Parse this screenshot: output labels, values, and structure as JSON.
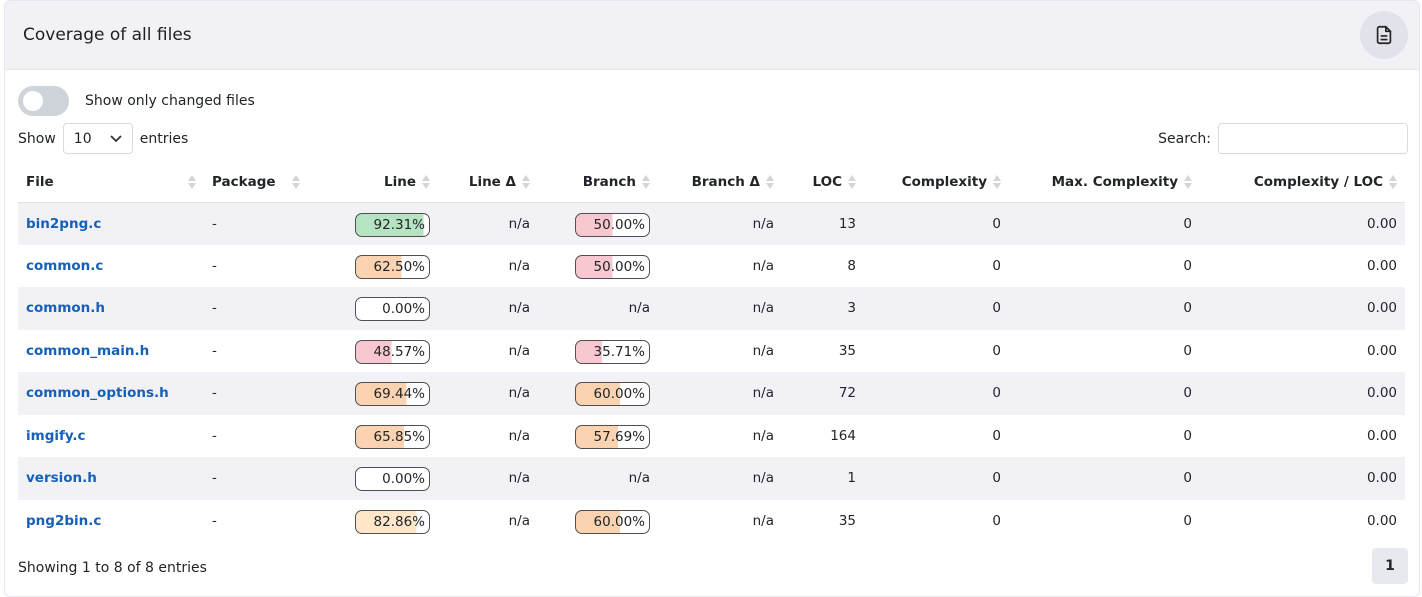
{
  "card": {
    "title": "Coverage of all files",
    "icon": "document-icon"
  },
  "toggle": {
    "label": "Show only changed files"
  },
  "length": {
    "prefix": "Show",
    "value": "10",
    "suffix": "entries"
  },
  "search": {
    "label": "Search:"
  },
  "columns": [
    "File",
    "Package",
    "Line",
    "Line Δ",
    "Branch",
    "Branch Δ",
    "LOC",
    "Complexity",
    "Max. Complexity",
    "Complexity / LOC"
  ],
  "colors": {
    "good": "#b6e3c2",
    "medium": "#fde7c8",
    "warn": "#fbd3b0",
    "bad": "#f9c7d0"
  },
  "rows": [
    {
      "file": "bin2png.c",
      "package": "-",
      "line": "92.31%",
      "line_pct": 92.31,
      "line_color": "good",
      "line_delta": "n/a",
      "branch": "50.00%",
      "branch_pct": 50.0,
      "branch_color": "bad",
      "branch_delta": "n/a",
      "loc": "13",
      "complexity": "0",
      "max_complexity": "0",
      "complexity_loc": "0.00"
    },
    {
      "file": "common.c",
      "package": "-",
      "line": "62.50%",
      "line_pct": 62.5,
      "line_color": "warn",
      "line_delta": "n/a",
      "branch": "50.00%",
      "branch_pct": 50.0,
      "branch_color": "bad",
      "branch_delta": "n/a",
      "loc": "8",
      "complexity": "0",
      "max_complexity": "0",
      "complexity_loc": "0.00"
    },
    {
      "file": "common.h",
      "package": "-",
      "line": "0.00%",
      "line_pct": 0,
      "line_color": "bad",
      "line_delta": "n/a",
      "branch": "n/a",
      "branch_pct": null,
      "branch_color": "",
      "branch_delta": "n/a",
      "loc": "3",
      "complexity": "0",
      "max_complexity": "0",
      "complexity_loc": "0.00"
    },
    {
      "file": "common_main.h",
      "package": "-",
      "line": "48.57%",
      "line_pct": 48.57,
      "line_color": "bad",
      "line_delta": "n/a",
      "branch": "35.71%",
      "branch_pct": 35.71,
      "branch_color": "bad",
      "branch_delta": "n/a",
      "loc": "35",
      "complexity": "0",
      "max_complexity": "0",
      "complexity_loc": "0.00"
    },
    {
      "file": "common_options.h",
      "package": "-",
      "line": "69.44%",
      "line_pct": 69.44,
      "line_color": "warn",
      "line_delta": "n/a",
      "branch": "60.00%",
      "branch_pct": 60.0,
      "branch_color": "warn",
      "branch_delta": "n/a",
      "loc": "72",
      "complexity": "0",
      "max_complexity": "0",
      "complexity_loc": "0.00"
    },
    {
      "file": "imgify.c",
      "package": "-",
      "line": "65.85%",
      "line_pct": 65.85,
      "line_color": "warn",
      "line_delta": "n/a",
      "branch": "57.69%",
      "branch_pct": 57.69,
      "branch_color": "warn",
      "branch_delta": "n/a",
      "loc": "164",
      "complexity": "0",
      "max_complexity": "0",
      "complexity_loc": "0.00"
    },
    {
      "file": "version.h",
      "package": "-",
      "line": "0.00%",
      "line_pct": 0,
      "line_color": "bad",
      "line_delta": "n/a",
      "branch": "n/a",
      "branch_pct": null,
      "branch_color": "",
      "branch_delta": "n/a",
      "loc": "1",
      "complexity": "0",
      "max_complexity": "0",
      "complexity_loc": "0.00"
    },
    {
      "file": "png2bin.c",
      "package": "-",
      "line": "82.86%",
      "line_pct": 82.86,
      "line_color": "medium",
      "line_delta": "n/a",
      "branch": "60.00%",
      "branch_pct": 60.0,
      "branch_color": "warn",
      "branch_delta": "n/a",
      "loc": "35",
      "complexity": "0",
      "max_complexity": "0",
      "complexity_loc": "0.00"
    }
  ],
  "footer": {
    "info": "Showing 1 to 8 of 8 entries",
    "page": "1"
  }
}
